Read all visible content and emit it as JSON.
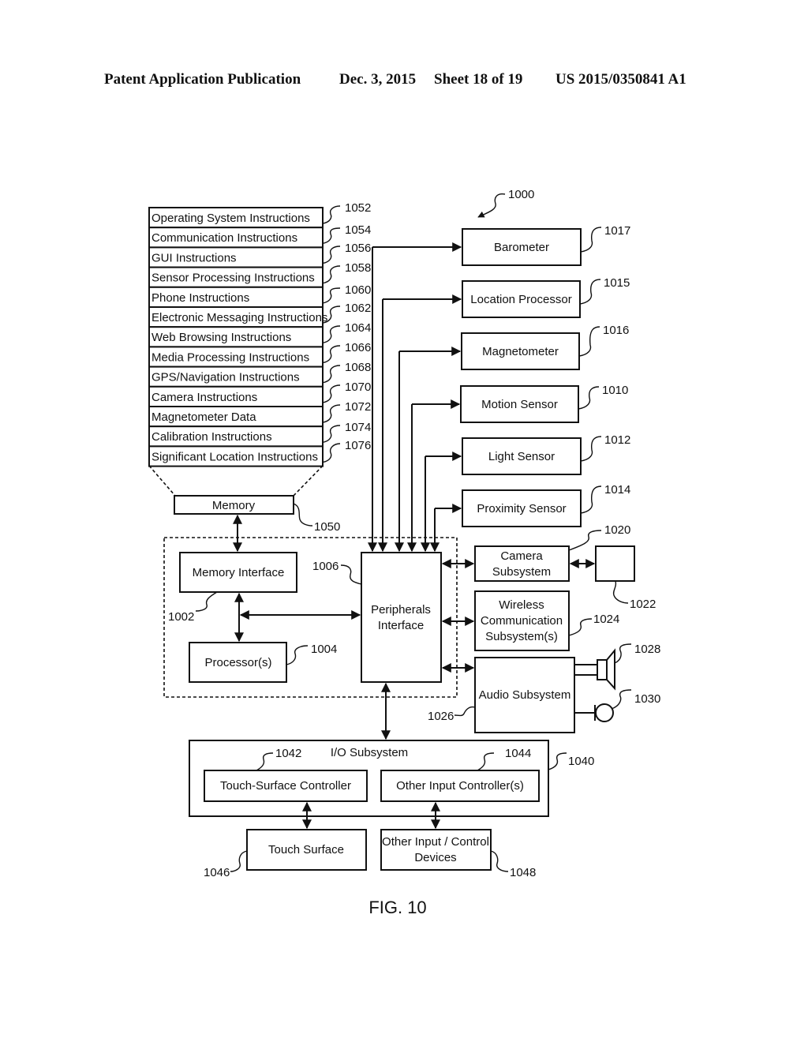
{
  "header": {
    "publication": "Patent Application Publication",
    "date": "Dec. 3, 2015",
    "sheet": "Sheet 18 of 19",
    "patent_number": "US 2015/0350841 A1"
  },
  "figure": {
    "caption": "FIG. 10",
    "system_ref": "1000"
  },
  "memory_stack": {
    "items": [
      {
        "label": "Operating System Instructions",
        "ref": "1052"
      },
      {
        "label": "Communication Instructions",
        "ref": "1054"
      },
      {
        "label": "GUI Instructions",
        "ref": "1056"
      },
      {
        "label": "Sensor Processing Instructions",
        "ref": "1058"
      },
      {
        "label": "Phone Instructions",
        "ref": "1060"
      },
      {
        "label": "Electronic Messaging Instructions",
        "ref": "1062"
      },
      {
        "label": "Web Browsing Instructions",
        "ref": "1064"
      },
      {
        "label": "Media Processing Instructions",
        "ref": "1066"
      },
      {
        "label": "GPS/Navigation Instructions",
        "ref": "1068"
      },
      {
        "label": "Camera Instructions",
        "ref": "1070"
      },
      {
        "label": "Magnetometer Data",
        "ref": "1072"
      },
      {
        "label": "Calibration Instructions",
        "ref": "1074"
      },
      {
        "label": "Significant Location Instructions",
        "ref": "1076"
      }
    ],
    "memory": {
      "label": "Memory",
      "ref": "1050"
    }
  },
  "sensors": [
    {
      "label": "Barometer",
      "ref": "1017"
    },
    {
      "label": "Location Processor",
      "ref": "1015"
    },
    {
      "label": "Magnetometer",
      "ref": "1016"
    },
    {
      "label": "Motion Sensor",
      "ref": "1010"
    },
    {
      "label": "Light Sensor",
      "ref": "1012"
    },
    {
      "label": "Proximity Sensor",
      "ref": "1014"
    }
  ],
  "core": {
    "memory_interface": {
      "label": "Memory Interface",
      "ref": "1002"
    },
    "processor": {
      "label": "Processor(s)",
      "ref": "1004"
    },
    "peripherals": {
      "line1": "Peripherals",
      "line2": "Interface",
      "ref": "1006"
    }
  },
  "subsystems": {
    "camera": {
      "line1": "Camera",
      "line2": "Subsystem",
      "ref": "1020",
      "sensor_ref": "1022"
    },
    "wireless": {
      "line1": "Wireless",
      "line2": "Communication",
      "line3": "Subsystem(s)",
      "ref": "1024"
    },
    "audio": {
      "label": "Audio Subsystem",
      "ref": "1026",
      "speaker_ref": "1028",
      "mic_ref": "1030"
    }
  },
  "io": {
    "title": "I/O Subsystem",
    "ref": "1040",
    "touch_controller": {
      "label": "Touch-Surface Controller",
      "ref": "1042"
    },
    "other_controller": {
      "label": "Other Input Controller(s)",
      "ref": "1044"
    },
    "touch_surface": {
      "label": "Touch Surface",
      "ref": "1046"
    },
    "other_devices": {
      "line1": "Other Input / Control",
      "line2": "Devices",
      "ref": "1048"
    }
  }
}
